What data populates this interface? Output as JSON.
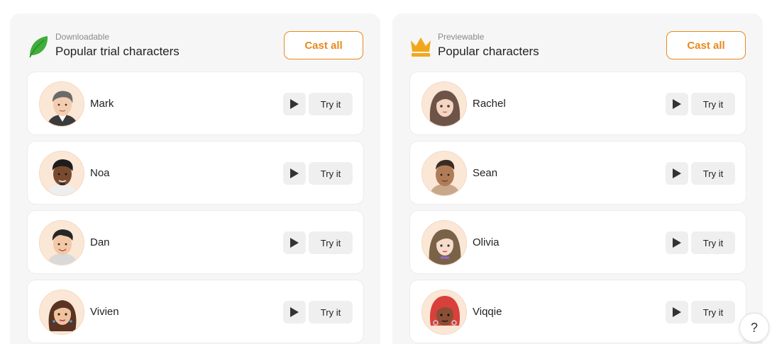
{
  "panels": [
    {
      "kicker": "Downloadable",
      "title": "Popular trial characters",
      "icon": "leaf-icon",
      "cast_all_label": "Cast all",
      "characters": [
        {
          "name": "Mark",
          "try_label": "Try it"
        },
        {
          "name": "Noa",
          "try_label": "Try it"
        },
        {
          "name": "Dan",
          "try_label": "Try it"
        },
        {
          "name": "Vivien",
          "try_label": "Try it"
        }
      ]
    },
    {
      "kicker": "Previewable",
      "title": "Popular characters",
      "icon": "crown-icon",
      "cast_all_label": "Cast all",
      "characters": [
        {
          "name": "Rachel",
          "try_label": "Try it"
        },
        {
          "name": "Sean",
          "try_label": "Try it"
        },
        {
          "name": "Olivia",
          "try_label": "Try it"
        },
        {
          "name": "Viqqie",
          "try_label": "Try it"
        }
      ]
    }
  ],
  "help": {
    "label": "?"
  },
  "colors": {
    "accent": "#e8891d",
    "leaf": "#3fae3a",
    "crown": "#f2a71b",
    "panel_bg": "#f6f6f6",
    "button_bg": "#efefef"
  }
}
